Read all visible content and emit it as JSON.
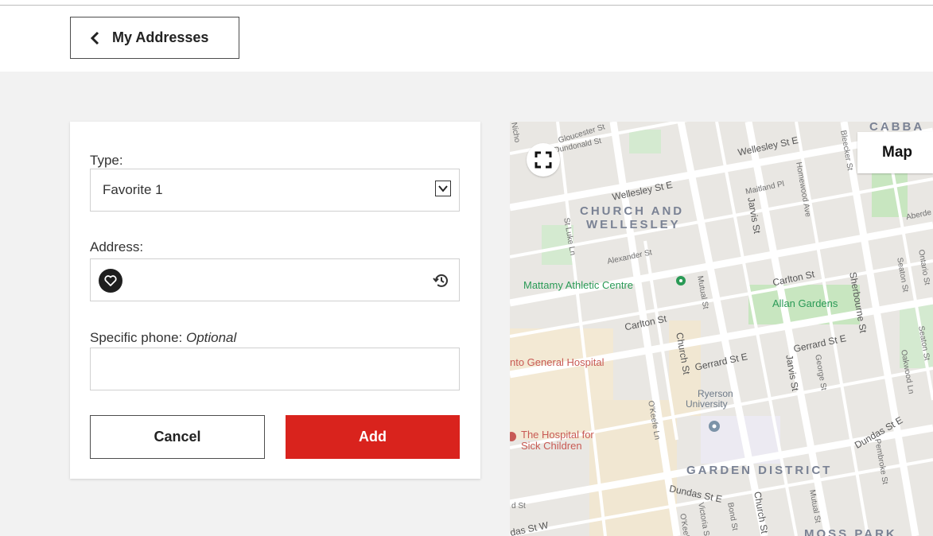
{
  "header": {
    "back_label": "My Addresses"
  },
  "form": {
    "type_label": "Type:",
    "type_value": "Favorite 1",
    "address_label": "Address:",
    "address_value": "",
    "phone_label": "Specific phone: ",
    "phone_optional": "Optional",
    "phone_value": "",
    "cancel_label": "Cancel",
    "add_label": "Add"
  },
  "colors": {
    "accent": "#d9231d",
    "park": "#c8e6c0",
    "poi_green": "#2a9a56",
    "poi_red": "#c85a54"
  },
  "icons": [
    "chevron-left-icon",
    "chevron-down-icon",
    "heart-icon",
    "history-icon",
    "fullscreen-icon",
    "map-pin-icon"
  ],
  "map": {
    "type_button": "Map",
    "labels": {
      "district1": "CHURCH AND",
      "district1b": "WELLESLEY",
      "district2": "GARDEN DISTRICT",
      "district3": "CABBA",
      "district4": "MOSS PARK",
      "poi1": "Mattamy Athletic Centre",
      "poi2": "Allan Gardens",
      "poi3": "nto General Hospital",
      "poi4a": "The Hospital for",
      "poi4b": "Sick Children",
      "poi5a": "Ryerson",
      "poi5b": "University",
      "st_wellesley_e": "Wellesley St E",
      "st_wellesley_e2": "Wellesley St E",
      "st_gloucester": "Gloucester St",
      "st_dundonald": "Dundonald St",
      "st_alexander": "Alexander St",
      "st_carlton": "Carlton St",
      "st_carlton2": "Carlton St",
      "st_gerrard": "Gerrard St E",
      "st_gerrard2": "Gerrard St E",
      "st_dundas": "Dundas St E",
      "st_dundas2": "Dundas St E",
      "st_dundas_w": "das St W",
      "st_church": "Church St",
      "st_church2": "Church St",
      "st_jarvis": "Jarvis St",
      "st_jarvis2": "Jarvis St",
      "st_sherbourne": "Sherbourne St",
      "st_mutual": "Mutual St",
      "st_mutual2": "Mutual St",
      "st_george": "George St",
      "st_okeefe": "O'Keefe Ln",
      "st_bleecker": "Bleecker St",
      "st_homewood": "Homewood Ave",
      "st_maitland": "Maitland Pl",
      "st_stluke": "St Luke Ln",
      "st_seaton": "Seaton St",
      "st_ontario": "Ontario St",
      "st_pembroke": "Pembroke St",
      "st_victoria": "Victoria St",
      "st_bond": "Bond St",
      "st_aberdeen": "Aberde",
      "st_nicho": "Nicho",
      "st_dst": "d St",
      "st_okee2": "O'Keefe",
      "st_oakvale": "Oakwood Ln",
      "st_seaton2": "Seaton St"
    }
  }
}
